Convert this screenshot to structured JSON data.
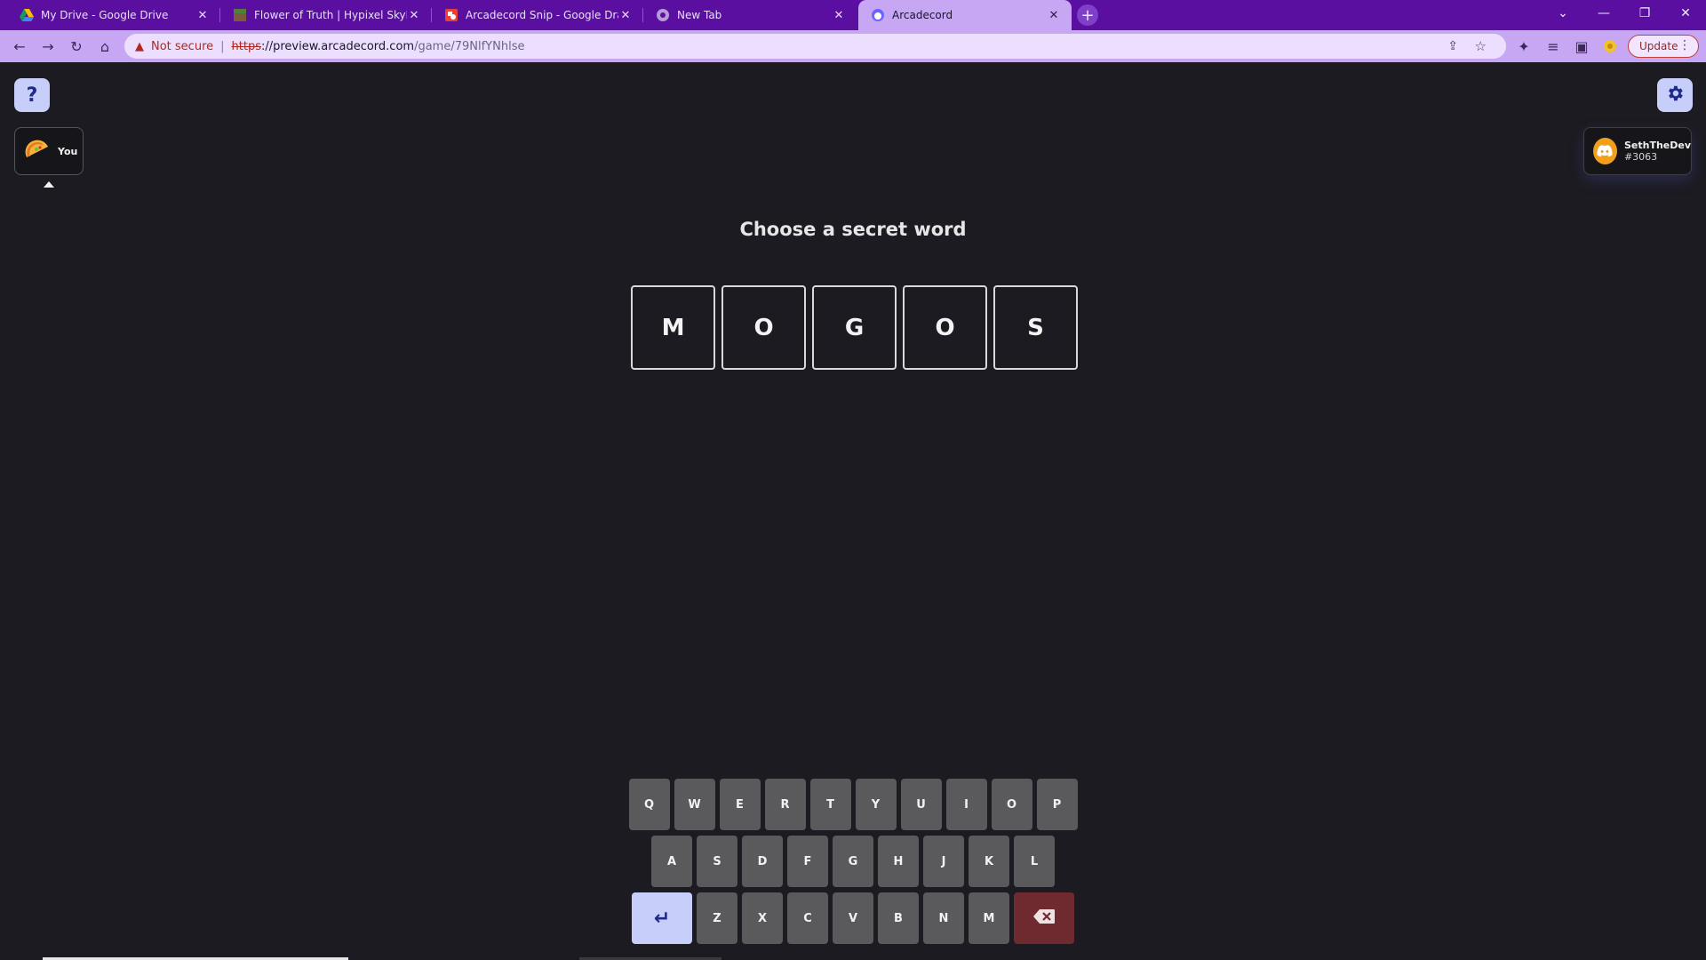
{
  "browser": {
    "tabs": [
      {
        "title": "My Drive - Google Drive",
        "icon": "google-drive-icon"
      },
      {
        "title": "Flower of Truth | Hypixel SkyBlock",
        "icon": "minecraft-block-icon"
      },
      {
        "title": "Arcadecord Snip - Google Drawings",
        "icon": "google-drawings-icon"
      },
      {
        "title": "New Tab",
        "icon": "chrome-icon"
      },
      {
        "title": "Arcadecord",
        "icon": "arcadecord-icon",
        "active": true
      }
    ],
    "new_tab_label": "+",
    "address": {
      "security_label": "Not secure",
      "separator": "|",
      "scheme": "https",
      "host_path": "://preview.arcadecord.com",
      "path_rest": "/game/79NlfYNhlse"
    },
    "update_label": "Update",
    "colors": {
      "frame": "#5a0fa0",
      "toolbar": "#c7a6f4",
      "accent": "#c7cef9"
    }
  },
  "game": {
    "help_label": "?",
    "player": {
      "label": "You",
      "avatar": "taco-icon"
    },
    "user": {
      "name": "SethTheDev",
      "tag": "#3063",
      "avatar": "discord-icon"
    },
    "title": "Choose a secret word",
    "tiles": [
      "M",
      "O",
      "G",
      "O",
      "S"
    ],
    "keyboard": {
      "row1": [
        "Q",
        "W",
        "E",
        "R",
        "T",
        "Y",
        "U",
        "I",
        "O",
        "P"
      ],
      "row2": [
        "A",
        "S",
        "D",
        "F",
        "G",
        "H",
        "J",
        "K",
        "L"
      ],
      "row3": [
        "Z",
        "X",
        "C",
        "V",
        "B",
        "N",
        "M"
      ],
      "enter_symbol": "↵"
    }
  }
}
